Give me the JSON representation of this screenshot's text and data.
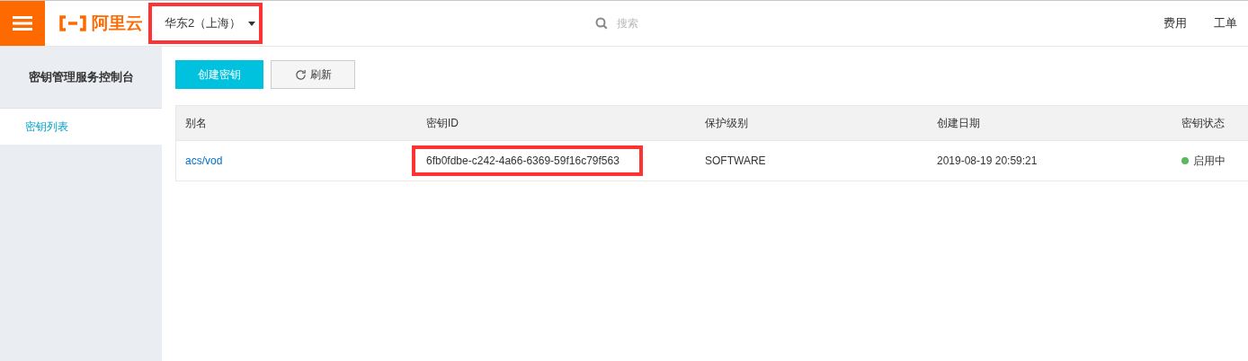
{
  "header": {
    "logo": "阿里云",
    "region": {
      "label": "华东2（上海）",
      "highlighted": true
    },
    "search": {
      "placeholder": "搜索"
    },
    "links": [
      "费用",
      "工单"
    ]
  },
  "sidebar": {
    "title": "密钥管理服务控制台",
    "items": [
      {
        "label": "密钥列表",
        "selected": true
      }
    ]
  },
  "toolbar": {
    "create_button": "创建密钥",
    "refresh_button": "刷新"
  },
  "table": {
    "columns": [
      "别名",
      "密钥ID",
      "保护级别",
      "创建日期",
      "密钥状态"
    ],
    "rows": [
      {
        "alias": "acs/vod",
        "key_id": "6fb0fdbe-c242-4a66-6369-59f16c79f563",
        "key_id_highlighted": true,
        "protection": "SOFTWARE",
        "created": "2019-08-19 20:59:21",
        "status": "启用中",
        "color": "#5cb85c"
      }
    ]
  }
}
